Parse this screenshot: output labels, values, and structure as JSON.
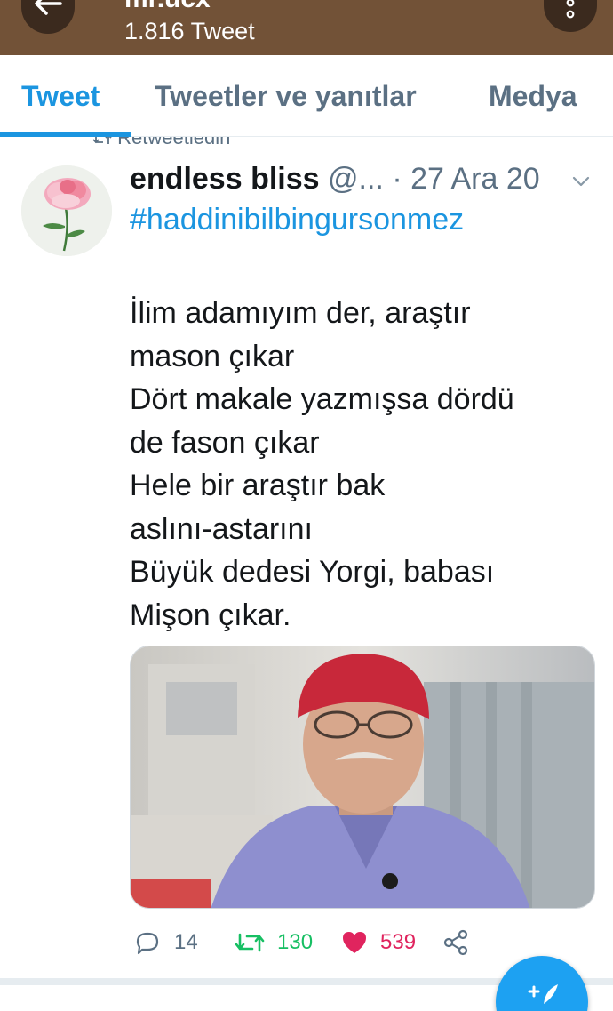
{
  "header": {
    "title": "mr.ucx",
    "tweet_count": "1.816 Tweet",
    "back_icon": "arrow-left-icon",
    "menu_icon": "more-vertical-icon"
  },
  "tabs": [
    {
      "label": "Tweet",
      "active": true
    },
    {
      "label": "Tweetler ve yanıtlar",
      "active": false
    },
    {
      "label": "Medya",
      "active": false
    }
  ],
  "tweet": {
    "retweeted_label": "Retweetledin",
    "author_name": "endless bliss",
    "handle": "@...",
    "separator": "·",
    "date": "27 Ara 20",
    "hashtag": "#haddinibilbingursonmez",
    "lines": [
      "İlim adamıyım der, araştır",
      "mason çıkar",
      "Dört makale yazmışsa dördü",
      "de fason çıkar",
      "Hele bir araştır bak",
      "aslını-astarını",
      "Büyük dedesi Yorgi, babası",
      "Mişon çıkar."
    ],
    "stats": {
      "replies": "14",
      "retweets": "130",
      "likes": "539"
    }
  },
  "colors": {
    "header_bg": "#725237",
    "accent": "#1b95e0",
    "retweet_green": "#17bf63",
    "like_red": "#e0245e",
    "muted": "#5b7083"
  }
}
